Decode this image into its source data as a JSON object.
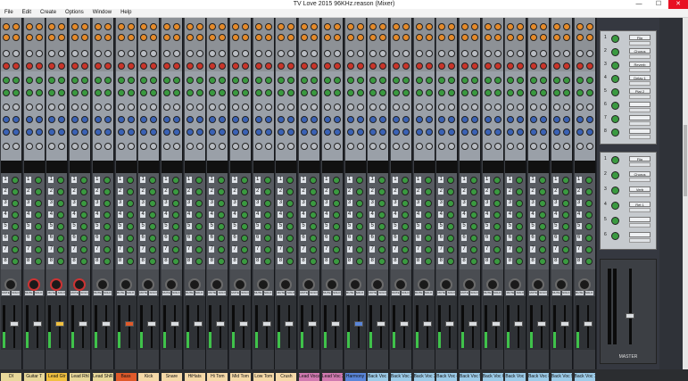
{
  "window": {
    "title": "TV Love 2015 96KHz.reason (Mixer)",
    "minimize": "—",
    "maximize": "☐",
    "close": "✕"
  },
  "menu": [
    "File",
    "Edit",
    "Create",
    "Options",
    "Window",
    "Help"
  ],
  "channels": [
    {
      "label": "DI",
      "color": "#e8d89a"
    },
    {
      "label": "Guitar T",
      "color": "#e8d89a"
    },
    {
      "label": "Lead Gtr",
      "color": "#f0c040"
    },
    {
      "label": "Lead Rhl",
      "color": "#e8d89a"
    },
    {
      "label": "Lead ShR",
      "color": "#e8d89a"
    },
    {
      "label": "Bass",
      "color": "#e05a2a"
    },
    {
      "label": "Kick",
      "color": "#f5d9a8"
    },
    {
      "label": "Snare",
      "color": "#f5d9a8"
    },
    {
      "label": "HiHats",
      "color": "#f5d9a8"
    },
    {
      "label": "Hi Tom",
      "color": "#f5d9a8"
    },
    {
      "label": "Mid Tom",
      "color": "#f5d9a8"
    },
    {
      "label": "Low Tom",
      "color": "#f5d9a8"
    },
    {
      "label": "Crush",
      "color": "#f5d9a8"
    },
    {
      "label": "Lead Vocal",
      "color": "#d07ab0"
    },
    {
      "label": "Lead Voc 2",
      "color": "#d07ab0"
    },
    {
      "label": "Harmony",
      "color": "#5a86d9"
    },
    {
      "label": "Back Voc 1",
      "color": "#9ccbe8"
    },
    {
      "label": "Back Voc 2",
      "color": "#9ccbe8"
    },
    {
      "label": "Back Voc 3",
      "color": "#9ccbe8"
    },
    {
      "label": "Back Voc 4",
      "color": "#9ccbe8"
    },
    {
      "label": "Back Voc 5",
      "color": "#9ccbe8"
    },
    {
      "label": "Back Voc 6",
      "color": "#9ccbe8"
    },
    {
      "label": "Back Voc 7",
      "color": "#9ccbe8"
    },
    {
      "label": "Back Voc 8",
      "color": "#9ccbe8"
    },
    {
      "label": "Back Voc 9",
      "color": "#9ccbe8"
    },
    {
      "label": "Back Voc 10",
      "color": "#9ccbe8"
    }
  ],
  "small_labels": {
    "lead_gtr": "Lead Gtr",
    "lead_rhl": "Lead Rhl"
  },
  "send_numbers": [
    "1",
    "2",
    "3",
    "4",
    "5",
    "6",
    "7",
    "8"
  ],
  "mute_label": "MUTE",
  "solo_label": "SOLO",
  "fx_returns": [
    {
      "num": "1",
      "name": "Flip"
    },
    {
      "num": "2",
      "name": "Chorus"
    },
    {
      "num": "3",
      "name": "Reverb"
    },
    {
      "num": "4",
      "name": "Delay 1"
    },
    {
      "num": "5",
      "name": "Plat 2"
    },
    {
      "num": "6",
      "name": ""
    },
    {
      "num": "7",
      "name": ""
    },
    {
      "num": "8",
      "name": ""
    }
  ],
  "fx_returns_2": [
    {
      "num": "1",
      "name": "Flip"
    },
    {
      "num": "2",
      "name": "Chorus"
    },
    {
      "num": "3",
      "name": "Verb"
    },
    {
      "num": "4",
      "name": "Ret 1"
    },
    {
      "num": "5",
      "name": ""
    },
    {
      "num": "6",
      "name": ""
    }
  ],
  "master": {
    "label": "MASTER"
  },
  "colors": {
    "accent_orange": "#e58a2a",
    "meter_green": "#3fc24a"
  }
}
